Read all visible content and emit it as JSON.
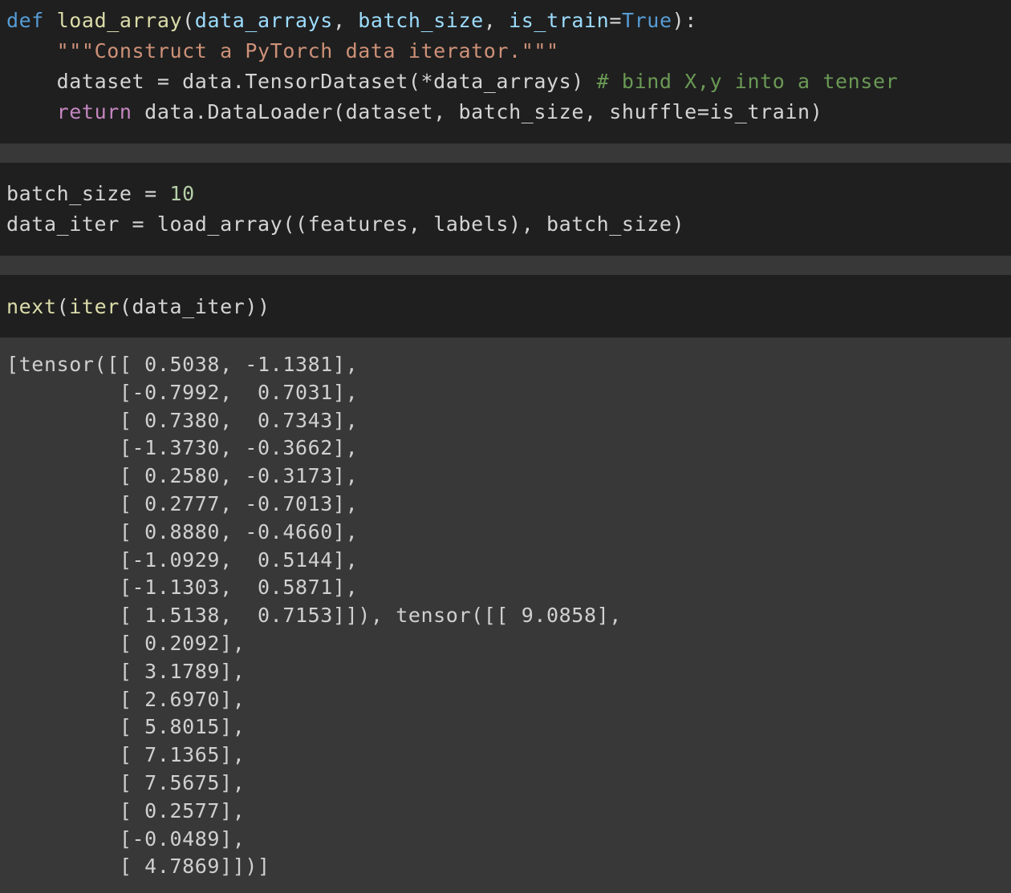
{
  "cell1": {
    "line1": {
      "kw": "def",
      "fn": "load_array",
      "open": "(",
      "p1": "data_arrays",
      "sep1": ", ",
      "p2": "batch_size",
      "sep2": ", ",
      "p3": "is_train",
      "eq": "=",
      "const": "True",
      "close": "):"
    },
    "line2": {
      "indent": "    ",
      "doc": "\"\"\"Construct a PyTorch data iterator.\"\"\""
    },
    "line3": {
      "indent": "    ",
      "code": "dataset = data.TensorDataset(*data_arrays) ",
      "comment": "# bind X,y into a tenser"
    },
    "line4": {
      "indent": "    ",
      "kw": "return",
      "code": " data.DataLoader(dataset, batch_size, shuffle=is_train)"
    }
  },
  "cell2": {
    "line1": {
      "code": "batch_size = ",
      "num": "10"
    },
    "line2": {
      "code": "data_iter = load_array((features, labels), batch_size)"
    }
  },
  "cell3": {
    "line1": {
      "fn1": "next",
      "p1": "(",
      "fn2": "iter",
      "rest": "(data_iter))"
    }
  },
  "output": [
    "[tensor([[ 0.5038, -1.1381],",
    "         [-0.7992,  0.7031],",
    "         [ 0.7380,  0.7343],",
    "         [-1.3730, -0.3662],",
    "         [ 0.2580, -0.3173],",
    "         [ 0.2777, -0.7013],",
    "         [ 0.8880, -0.4660],",
    "         [-1.0929,  0.5144],",
    "         [-1.1303,  0.5871],",
    "         [ 1.5138,  0.7153]]), tensor([[ 9.0858],",
    "         [ 0.2092],",
    "         [ 3.1789],",
    "         [ 2.6970],",
    "         [ 5.8015],",
    "         [ 7.1365],",
    "         [ 7.5675],",
    "         [ 0.2577],",
    "         [-0.0489],",
    "         [ 4.7869]])]"
  ]
}
